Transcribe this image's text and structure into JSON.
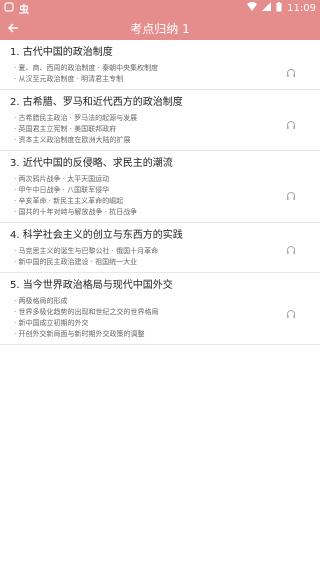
{
  "status": {
    "app_badge": "虫",
    "time": "11:09"
  },
  "header": {
    "title": "考点归纳 1"
  },
  "units": [
    {
      "title": "1. 古代中国的政治制度",
      "lessons": [
        "· 夏、商、西周的政治制度 · 秦朝中央集权制度",
        "· 从汉至元政治制度 · 明清君主专制"
      ]
    },
    {
      "title": "2. 古希腊、罗马和近代西方的政治制度",
      "lessons": [
        "· 古希腊民主政治 · 罗马法的起源与发展",
        "· 英国君主立宪制 · 美国联邦政府",
        "· 资本主义政治制度在欧洲大陆的扩展"
      ]
    },
    {
      "title": "3. 近代中国的反侵略、求民主的潮流",
      "lessons": [
        "· 两次鸦片战争 · 太平天国运动",
        "· 甲午中日战争 · 八国联军侵华",
        "· 辛亥革命 · 新民主主义革命的崛起",
        "· 国共的十年对峙与解放战争 · 抗日战争"
      ]
    },
    {
      "title": "4. 科学社会主义的创立与东西方的实践",
      "lessons": [
        "· 马克思主义的诞生与巴黎公社 · 俄国十月革命",
        "· 新中国的民主政治建设 · 祖国统一大业"
      ]
    },
    {
      "title": "5. 当今世界政治格局与现代中国外交",
      "lessons": [
        "· 两极格局的形成",
        "· 世界多极化趋势的出现和世纪之交的世界格局",
        "· 新中国成立初期的外交",
        "· 开创外交新局面与新时期外交政策的调整"
      ]
    }
  ]
}
